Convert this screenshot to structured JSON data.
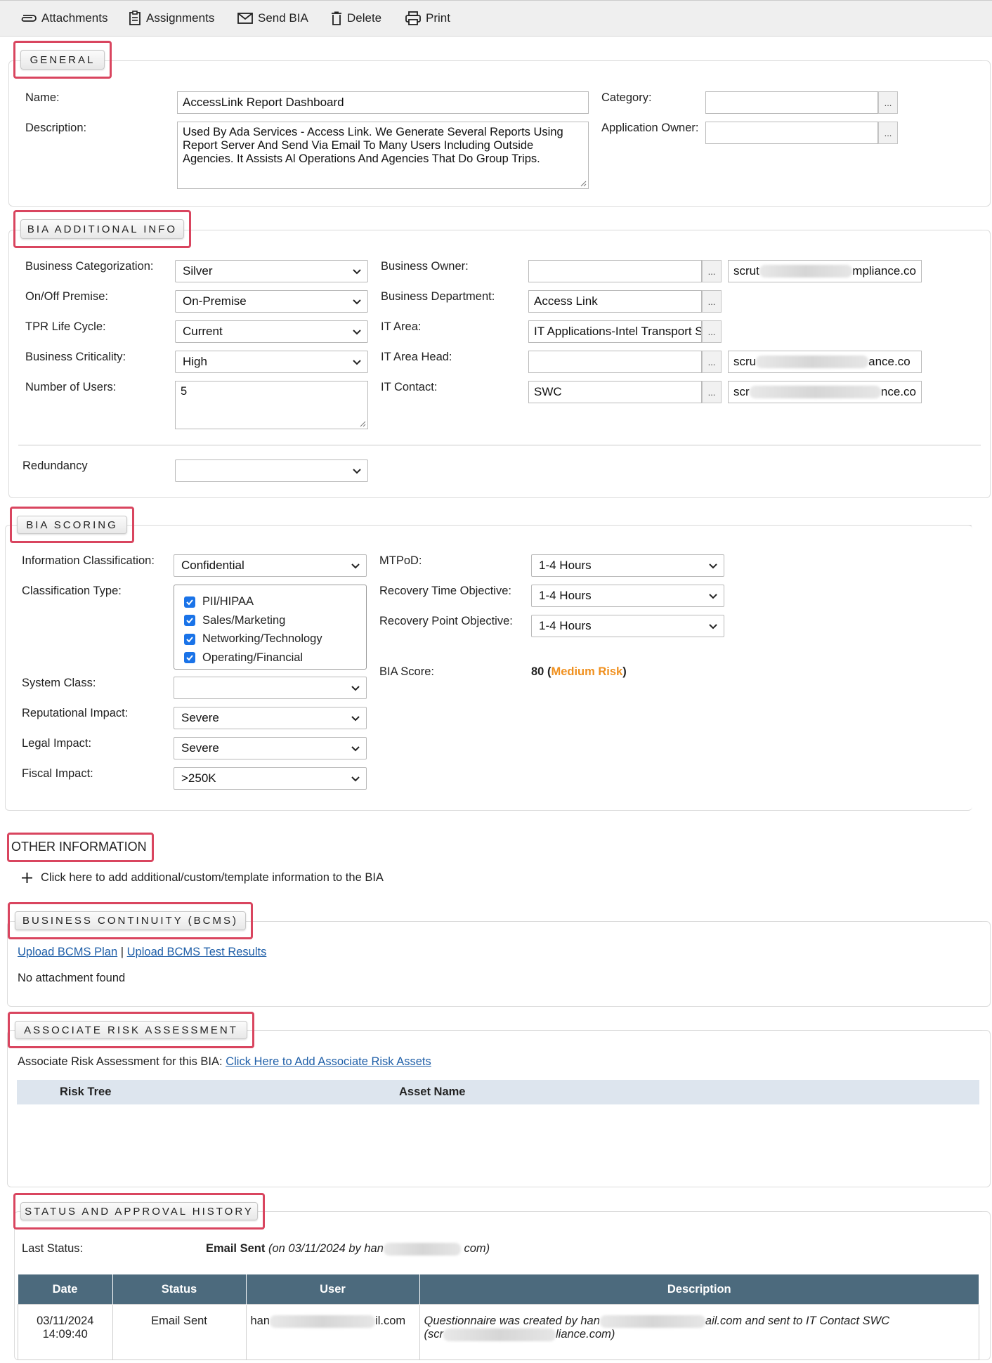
{
  "toolbar": {
    "items": [
      {
        "label": "Attachments",
        "icon": "paperclip-icon"
      },
      {
        "label": "Assignments",
        "icon": "clipboard-icon"
      },
      {
        "label": "Send BIA",
        "icon": "envelope-icon"
      },
      {
        "label": "Delete",
        "icon": "trash-icon"
      },
      {
        "label": "Print",
        "icon": "printer-icon"
      }
    ]
  },
  "general": {
    "header": "GENERAL",
    "name_label": "Name:",
    "name_value": "AccessLink Report Dashboard",
    "description_label": "Description:",
    "description_value": "Used By Ada Services - Access Link.  We Generate Several Reports Using Report Server And Send Via Email To Many Users Including Outside Agencies.   It Assists Al Operations And Agencies That Do Group Trips.",
    "category_label": "Category:",
    "category_value": "",
    "app_owner_label": "Application Owner:",
    "app_owner_value": "",
    "ellipsis": "..."
  },
  "bia_additional": {
    "header": "BIA ADDITIONAL INFO",
    "business_categorization_label": "Business Categorization:",
    "business_categorization_value": "Silver",
    "on_off_premise_label": "On/Off Premise:",
    "on_off_premise_value": "On-Premise",
    "tpr_life_cycle_label": "TPR Life Cycle:",
    "tpr_life_cycle_value": "Current",
    "business_criticality_label": "Business Criticality:",
    "business_criticality_value": "High",
    "number_of_users_label": "Number of Users:",
    "number_of_users_value": "5",
    "redundancy_label": "Redundancy",
    "redundancy_value": "",
    "business_owner_label": "Business Owner:",
    "business_owner_value": "",
    "business_owner_email_start": "scrut",
    "business_owner_email_end": "mpliance.co",
    "business_department_label": "Business Department:",
    "business_department_value": "Access Link",
    "it_area_label": "IT Area:",
    "it_area_value": "IT Applications-Intel Transport S",
    "it_area_head_label": "IT Area Head:",
    "it_area_head_value": "",
    "it_area_head_email_start": "scru",
    "it_area_head_email_end": "ance.co",
    "it_contact_label": "IT Contact:",
    "it_contact_value": "SWC",
    "it_contact_email_start": "scr",
    "it_contact_email_end": "nce.co"
  },
  "bia_scoring": {
    "header": "BIA SCORING",
    "info_class_label": "Information Classification:",
    "info_class_value": "Confidential",
    "class_type_label": "Classification Type:",
    "class_types": [
      "PII/HIPAA",
      "Sales/Marketing",
      "Networking/Technology",
      "Operating/Financial"
    ],
    "system_class_label": "System Class:",
    "system_class_value": "",
    "reputational_label": "Reputational Impact:",
    "reputational_value": "Severe",
    "legal_label": "Legal Impact:",
    "legal_value": "Severe",
    "fiscal_label": "Fiscal Impact:",
    "fiscal_value": ">250K",
    "mtpod_label": "MTPoD:",
    "mtpod_value": "1-4 Hours",
    "rto_label": "Recovery Time Objective:",
    "rto_value": "1-4 Hours",
    "rpo_label": "Recovery Point Objective:",
    "rpo_value": "1-4 Hours",
    "score_label": "BIA Score:",
    "score_value": "80",
    "score_paren_open": "(",
    "score_risk": "Medium Risk",
    "score_paren_close": ")",
    "risk_color": "#f0901e"
  },
  "other_info": {
    "header": "OTHER INFORMATION",
    "add_text": "Click here to add additional/custom/template information to the BIA"
  },
  "bcms": {
    "header": "BUSINESS CONTINUITY (BCMS)",
    "upload_plan": "Upload BCMS Plan",
    "separator": "|",
    "upload_test": "Upload BCMS Test Results",
    "no_attachment": "No attachment found"
  },
  "risk": {
    "header": "ASSOCIATE RISK ASSESSMENT",
    "intro": "Associate Risk Assessment for this BIA:",
    "add_link": "Click Here to Add Associate Risk Assets",
    "col_risk_tree": "Risk Tree",
    "col_asset_name": "Asset Name"
  },
  "status": {
    "header": "STATUS AND APPROVAL HISTORY",
    "last_status_label": "Last Status:",
    "last_status_value": "Email Sent",
    "last_status_detail_start": "(on 03/11/2024 by han",
    "last_status_detail_end": "com)",
    "columns": [
      "Date",
      "Status",
      "User",
      "Description"
    ],
    "row": {
      "date": "03/11/2024",
      "time": "14:09:40",
      "status": "Email Sent",
      "user_start": "han",
      "user_end": "il.com",
      "desc_line1_start": "Questionnaire was created by han",
      "desc_line1_end": "ail.com and sent to IT Contact SWC",
      "desc_line2_start": "(scr",
      "desc_line2_end": "liance.com)"
    }
  }
}
